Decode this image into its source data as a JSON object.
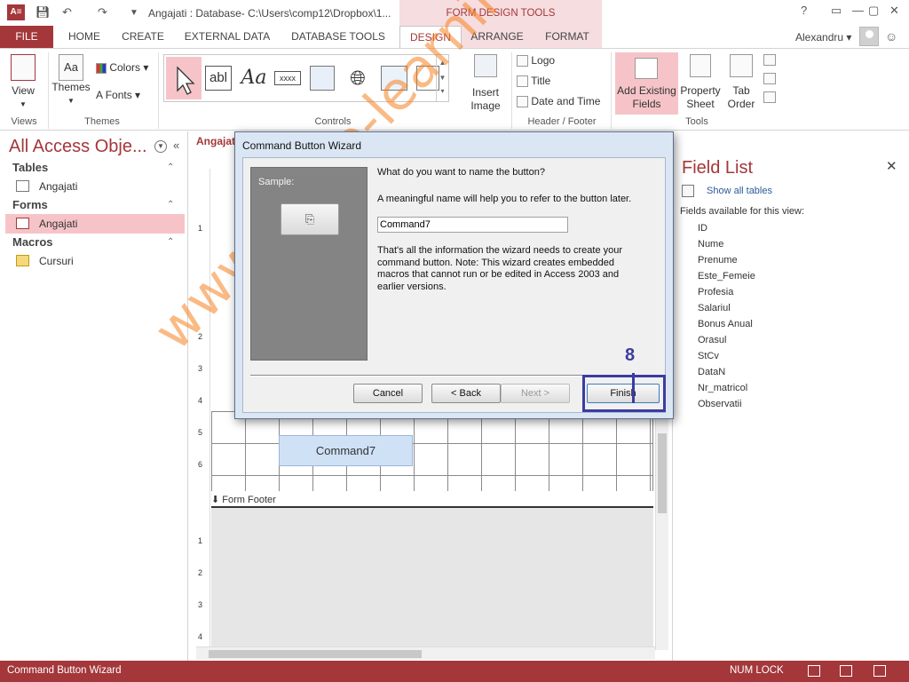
{
  "window": {
    "app_icon": "A≡",
    "title": "Angajati : Database- C:\\Users\\comp12\\Dropbox\\1...",
    "context_group": "FORM DESIGN TOOLS",
    "user": "Alexandru",
    "controls": [
      "?",
      "▭",
      "—",
      "▢",
      "✕"
    ]
  },
  "tabs": [
    "FILE",
    "HOME",
    "CREATE",
    "EXTERNAL DATA",
    "DATABASE TOOLS",
    "DESIGN",
    "ARRANGE",
    "FORMAT"
  ],
  "ribbon": {
    "view": "View",
    "themes": "Themes",
    "colors": "Colors",
    "fonts": "Fonts",
    "gallery": [
      "abl",
      "Aa",
      "xxxx"
    ],
    "insert_image": "Insert Image",
    "logo": "Logo",
    "title": "Title",
    "date_time": "Date and Time",
    "add_existing_fields": "Add Existing Fields",
    "property_sheet": "Property Sheet",
    "tab_order": "Tab Order",
    "groups": {
      "views": "Views",
      "themes": "Themes",
      "controls": "Controls",
      "header_footer": "Header / Footer",
      "tools": "Tools"
    }
  },
  "nav": {
    "title": "All Access Obje...",
    "categories": [
      {
        "name": "Tables",
        "items": [
          "Angajati"
        ]
      },
      {
        "name": "Forms",
        "items": [
          "Angajati"
        ]
      },
      {
        "name": "Macros",
        "items": [
          "Cursuri"
        ]
      }
    ]
  },
  "document": {
    "tab": "Angajati",
    "ruler": [
      "1",
      "2",
      "3",
      "4",
      "5",
      "6",
      "1",
      "2",
      "3",
      "4"
    ],
    "command_button": "Command7",
    "form_footer": "Form Footer"
  },
  "wizard": {
    "title": "Command Button Wizard",
    "sample_label": "Sample:",
    "question": "What do you want to name the button?",
    "hint": "A meaningful name will help you to refer to the button later.",
    "name_value": "Command7",
    "info": "That's all the information the wizard needs to create your command button. Note: This wizard creates embedded macros that cannot run or be edited in Access 2003 and earlier versions.",
    "buttons": {
      "cancel": "Cancel",
      "back": "< Back",
      "next": "Next >",
      "finish": "Finish"
    },
    "step": "8"
  },
  "field_list": {
    "title": "Field List",
    "show_all": "Show all tables",
    "available": "Fields available for this view:",
    "fields": [
      "ID",
      "Nume",
      "Prenume",
      "Este_Femeie",
      "Profesia",
      "Salariul",
      "Bonus Anual",
      "Orasul",
      "StCv",
      "DataN",
      "Nr_matricol",
      "Observatii"
    ]
  },
  "status": {
    "text": "Command Button Wizard",
    "numlock": "NUM LOCK"
  },
  "watermark": "www.office-learning.ro",
  "colors": {
    "accent": "#a4373a",
    "highlight": "#3c3ca0"
  }
}
